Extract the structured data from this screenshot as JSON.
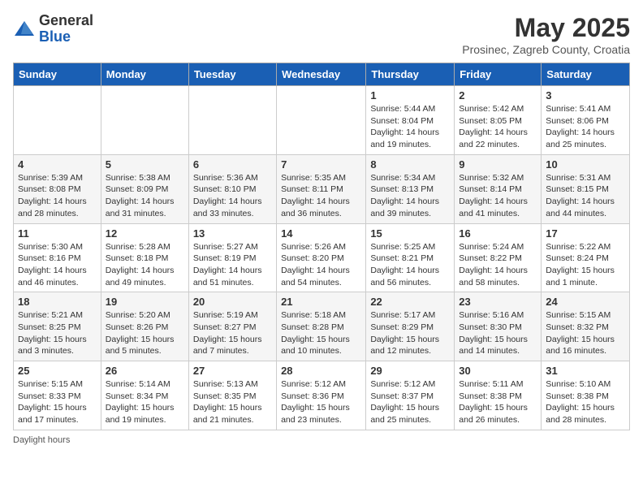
{
  "header": {
    "logo_general": "General",
    "logo_blue": "Blue",
    "month_year": "May 2025",
    "location": "Prosinec, Zagreb County, Croatia"
  },
  "days_of_week": [
    "Sunday",
    "Monday",
    "Tuesday",
    "Wednesday",
    "Thursday",
    "Friday",
    "Saturday"
  ],
  "footer": "Daylight hours",
  "weeks": [
    [
      {
        "day": "",
        "info": ""
      },
      {
        "day": "",
        "info": ""
      },
      {
        "day": "",
        "info": ""
      },
      {
        "day": "",
        "info": ""
      },
      {
        "day": "1",
        "info": "Sunrise: 5:44 AM\nSunset: 8:04 PM\nDaylight: 14 hours\nand 19 minutes."
      },
      {
        "day": "2",
        "info": "Sunrise: 5:42 AM\nSunset: 8:05 PM\nDaylight: 14 hours\nand 22 minutes."
      },
      {
        "day": "3",
        "info": "Sunrise: 5:41 AM\nSunset: 8:06 PM\nDaylight: 14 hours\nand 25 minutes."
      }
    ],
    [
      {
        "day": "4",
        "info": "Sunrise: 5:39 AM\nSunset: 8:08 PM\nDaylight: 14 hours\nand 28 minutes."
      },
      {
        "day": "5",
        "info": "Sunrise: 5:38 AM\nSunset: 8:09 PM\nDaylight: 14 hours\nand 31 minutes."
      },
      {
        "day": "6",
        "info": "Sunrise: 5:36 AM\nSunset: 8:10 PM\nDaylight: 14 hours\nand 33 minutes."
      },
      {
        "day": "7",
        "info": "Sunrise: 5:35 AM\nSunset: 8:11 PM\nDaylight: 14 hours\nand 36 minutes."
      },
      {
        "day": "8",
        "info": "Sunrise: 5:34 AM\nSunset: 8:13 PM\nDaylight: 14 hours\nand 39 minutes."
      },
      {
        "day": "9",
        "info": "Sunrise: 5:32 AM\nSunset: 8:14 PM\nDaylight: 14 hours\nand 41 minutes."
      },
      {
        "day": "10",
        "info": "Sunrise: 5:31 AM\nSunset: 8:15 PM\nDaylight: 14 hours\nand 44 minutes."
      }
    ],
    [
      {
        "day": "11",
        "info": "Sunrise: 5:30 AM\nSunset: 8:16 PM\nDaylight: 14 hours\nand 46 minutes."
      },
      {
        "day": "12",
        "info": "Sunrise: 5:28 AM\nSunset: 8:18 PM\nDaylight: 14 hours\nand 49 minutes."
      },
      {
        "day": "13",
        "info": "Sunrise: 5:27 AM\nSunset: 8:19 PM\nDaylight: 14 hours\nand 51 minutes."
      },
      {
        "day": "14",
        "info": "Sunrise: 5:26 AM\nSunset: 8:20 PM\nDaylight: 14 hours\nand 54 minutes."
      },
      {
        "day": "15",
        "info": "Sunrise: 5:25 AM\nSunset: 8:21 PM\nDaylight: 14 hours\nand 56 minutes."
      },
      {
        "day": "16",
        "info": "Sunrise: 5:24 AM\nSunset: 8:22 PM\nDaylight: 14 hours\nand 58 minutes."
      },
      {
        "day": "17",
        "info": "Sunrise: 5:22 AM\nSunset: 8:24 PM\nDaylight: 15 hours\nand 1 minute."
      }
    ],
    [
      {
        "day": "18",
        "info": "Sunrise: 5:21 AM\nSunset: 8:25 PM\nDaylight: 15 hours\nand 3 minutes."
      },
      {
        "day": "19",
        "info": "Sunrise: 5:20 AM\nSunset: 8:26 PM\nDaylight: 15 hours\nand 5 minutes."
      },
      {
        "day": "20",
        "info": "Sunrise: 5:19 AM\nSunset: 8:27 PM\nDaylight: 15 hours\nand 7 minutes."
      },
      {
        "day": "21",
        "info": "Sunrise: 5:18 AM\nSunset: 8:28 PM\nDaylight: 15 hours\nand 10 minutes."
      },
      {
        "day": "22",
        "info": "Sunrise: 5:17 AM\nSunset: 8:29 PM\nDaylight: 15 hours\nand 12 minutes."
      },
      {
        "day": "23",
        "info": "Sunrise: 5:16 AM\nSunset: 8:30 PM\nDaylight: 15 hours\nand 14 minutes."
      },
      {
        "day": "24",
        "info": "Sunrise: 5:15 AM\nSunset: 8:32 PM\nDaylight: 15 hours\nand 16 minutes."
      }
    ],
    [
      {
        "day": "25",
        "info": "Sunrise: 5:15 AM\nSunset: 8:33 PM\nDaylight: 15 hours\nand 17 minutes."
      },
      {
        "day": "26",
        "info": "Sunrise: 5:14 AM\nSunset: 8:34 PM\nDaylight: 15 hours\nand 19 minutes."
      },
      {
        "day": "27",
        "info": "Sunrise: 5:13 AM\nSunset: 8:35 PM\nDaylight: 15 hours\nand 21 minutes."
      },
      {
        "day": "28",
        "info": "Sunrise: 5:12 AM\nSunset: 8:36 PM\nDaylight: 15 hours\nand 23 minutes."
      },
      {
        "day": "29",
        "info": "Sunrise: 5:12 AM\nSunset: 8:37 PM\nDaylight: 15 hours\nand 25 minutes."
      },
      {
        "day": "30",
        "info": "Sunrise: 5:11 AM\nSunset: 8:38 PM\nDaylight: 15 hours\nand 26 minutes."
      },
      {
        "day": "31",
        "info": "Sunrise: 5:10 AM\nSunset: 8:38 PM\nDaylight: 15 hours\nand 28 minutes."
      }
    ]
  ]
}
